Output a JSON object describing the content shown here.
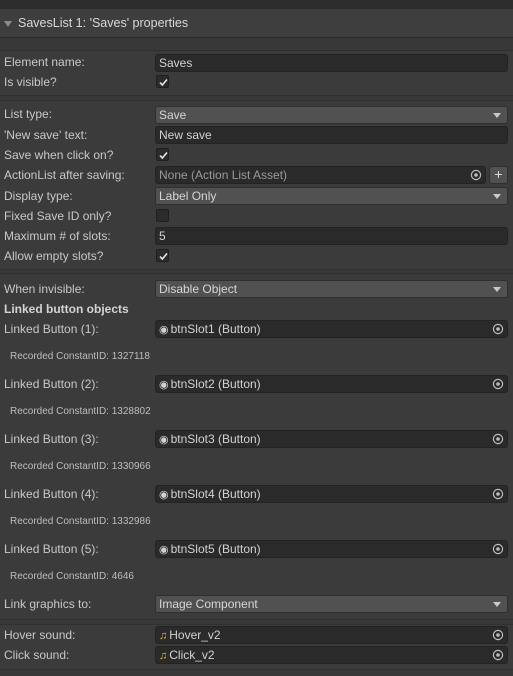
{
  "header": {
    "title": "SavesList 1: 'Saves' properties"
  },
  "fields": {
    "element_name": {
      "label": "Element name:",
      "value": "Saves"
    },
    "is_visible": {
      "label": "Is visible?",
      "checked": true
    },
    "list_type": {
      "label": "List type:",
      "value": "Save"
    },
    "new_save_text": {
      "label": "'New save' text:",
      "value": "New save"
    },
    "save_when_click": {
      "label": "Save when click on?",
      "checked": true
    },
    "actionlist_after": {
      "label": "ActionList after saving:",
      "value": "None (Action List Asset)",
      "plus": "+"
    },
    "display_type": {
      "label": "Display type:",
      "value": "Label Only"
    },
    "fixed_save_id": {
      "label": "Fixed Save ID only?",
      "checked": false
    },
    "max_slots": {
      "label": "Maximum # of slots:",
      "value": "5"
    },
    "allow_empty": {
      "label": "Allow empty slots?",
      "checked": true
    },
    "when_invisible": {
      "label": "When invisible:",
      "value": "Disable Object"
    },
    "linked_header": "Linked button objects",
    "link_graphics": {
      "label": "Link graphics to:",
      "value": "Image Component"
    },
    "hover_sound": {
      "label": "Hover sound:",
      "value": "Hover_v2"
    },
    "click_sound": {
      "label": "Click sound:",
      "value": "Click_v2"
    }
  },
  "linked_buttons": [
    {
      "label": "Linked Button (1):",
      "value": "btnSlot1 (Button)",
      "recorded": "Recorded ConstantID: 1327118"
    },
    {
      "label": "Linked Button (2):",
      "value": "btnSlot2 (Button)",
      "recorded": "Recorded ConstantID: 1328802"
    },
    {
      "label": "Linked Button (3):",
      "value": "btnSlot3 (Button)",
      "recorded": "Recorded ConstantID: 1330966"
    },
    {
      "label": "Linked Button (4):",
      "value": "btnSlot4 (Button)",
      "recorded": "Recorded ConstantID: 1332986"
    },
    {
      "label": "Linked Button (5):",
      "value": "btnSlot5 (Button)",
      "recorded": "Recorded ConstantID: 4646"
    }
  ],
  "icons": {
    "collapse": "triangle-down-icon",
    "dropdown": "chevron-down-icon",
    "picker": "object-picker-icon",
    "button_ref": "radio-dot-icon",
    "audio": "music-note-icon",
    "check": "checkmark-icon"
  },
  "colors": {
    "background": "#383838",
    "field": "#2a2a2a",
    "dropdown": "#515151",
    "audio_icon": "#e0b33a"
  }
}
